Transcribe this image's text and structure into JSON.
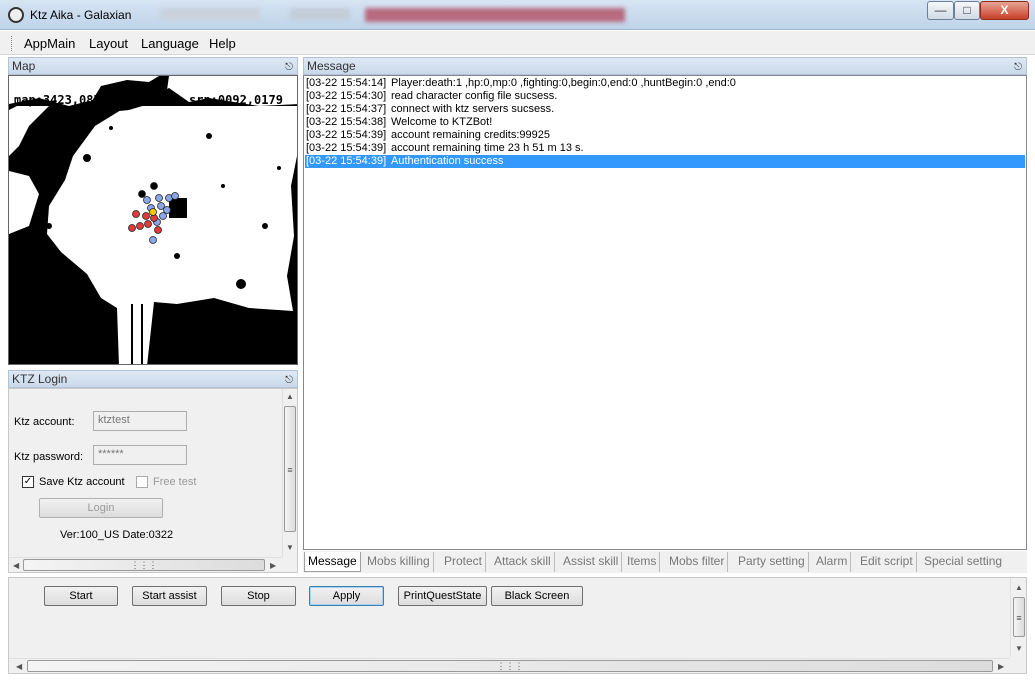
{
  "window": {
    "title": "Ktz Aika - Galaxian",
    "minimize_label": "—",
    "maximize_label": "□",
    "close_label": "X"
  },
  "menu": [
    "AppMain",
    "Layout",
    "Language",
    "Help"
  ],
  "map_panel": {
    "title": "Map",
    "map_coord": "map:3423,0879",
    "screen_coord": "srn:0092,0179"
  },
  "login_panel": {
    "title": "KTZ Login",
    "account_label": "Ktz account:",
    "account_value": "ktztest",
    "password_label": "Ktz password:",
    "password_value": "******",
    "save_account_label": "Save Ktz account",
    "save_account_checked": true,
    "free_test_label": "Free test",
    "free_test_checked": false,
    "login_button": "Login",
    "version": "Ver:100_US Date:0322"
  },
  "message_panel": {
    "title": "Message",
    "messages": [
      {
        "time": "[03-22 15:54:14]",
        "text": "Player:death:1 ,hp:0,mp:0 ,fighting:0,begin:0,end:0 ,huntBegin:0 ,end:0"
      },
      {
        "time": "[03-22 15:54:30]",
        "text": "read character config file sucsess."
      },
      {
        "time": "[03-22 15:54:37]",
        "text": "connect with ktz servers sucsess."
      },
      {
        "time": "[03-22 15:54:38]",
        "text": "Welcome to KTZBot!"
      },
      {
        "time": "[03-22 15:54:39]",
        "text": "account remaining credits:99925"
      },
      {
        "time": "[03-22 15:54:39]",
        "text": "account remaining time 23 h 51 m 13 s."
      },
      {
        "time": "[03-22 15:54:39]",
        "text": "Authentication success"
      }
    ],
    "selected_index": 6
  },
  "tabs": [
    "Message",
    "Mobs killing",
    "Protect",
    "Attack skill",
    "Assist skill",
    "Items",
    "Mobs filter",
    "Party setting",
    "Alarm",
    "Edit script",
    "Special setting"
  ],
  "active_tab": "Message",
  "buttons": {
    "start": "Start",
    "start_assist": "Start assist",
    "stop": "Stop",
    "apply": "Apply",
    "print_quest_state": "PrintQuestState",
    "black_screen": "Black Screen"
  },
  "icons": {
    "app": "app-icon",
    "pin": "pin-icon",
    "up_arrow": "scroll-up-arrow-icon",
    "down_arrow": "scroll-down-arrow-icon",
    "left_arrow": "scroll-left-arrow-icon",
    "right_arrow": "scroll-right-arrow-icon"
  },
  "colors": {
    "selection": "#3399ff",
    "panel_header": "#c9d9ea",
    "close_button": "#c7402a",
    "map_player": "#f5c400",
    "map_enemy": "#e03a3a",
    "map_ally": "#8aa6e8"
  }
}
